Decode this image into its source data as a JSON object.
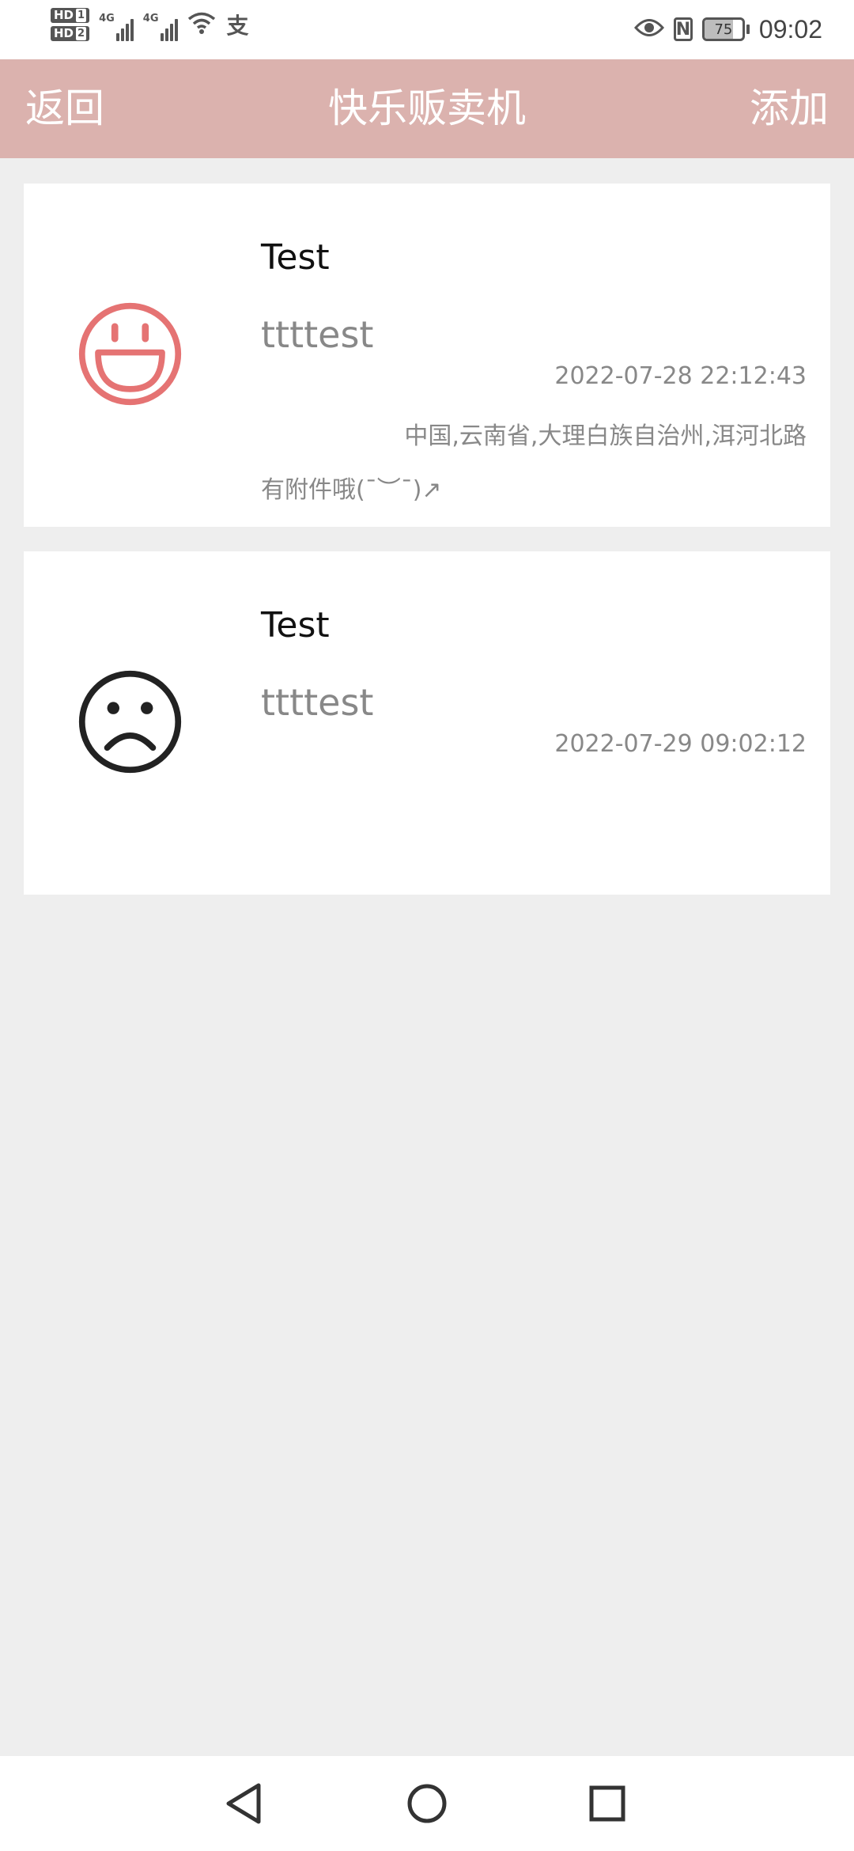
{
  "status_bar": {
    "sim1_label": "HD",
    "sim1_num": "1",
    "sim2_label": "HD",
    "sim2_num": "2",
    "network1": "4G",
    "network2": "4G",
    "alipay_glyph": "支",
    "battery_level": "75",
    "time": "09:02",
    "icons": [
      "wifi-icon",
      "alipay-icon",
      "eye-icon",
      "nfc-icon",
      "battery-icon"
    ]
  },
  "header": {
    "back_label": "返回",
    "title": "快乐贩卖机",
    "add_label": "添加",
    "background_color": "#dbb2ae"
  },
  "entries": [
    {
      "mood": "happy",
      "mood_icon": "happy-face-icon",
      "icon_color": "#e57373",
      "title": "Test",
      "content": "ttttest",
      "time": "2022-07-28 22:12:43",
      "location": "中国,云南省,大理白族自治州,洱河北路",
      "attachment": "有附件哦(ˉ︶ˉ)↗"
    },
    {
      "mood": "sad",
      "mood_icon": "sad-face-icon",
      "icon_color": "#222222",
      "title": "Test",
      "content": "ttttest",
      "time": "2022-07-29 09:02:12",
      "location": "",
      "attachment": ""
    }
  ],
  "nav_bar": {
    "buttons": [
      "back-triangle-icon",
      "home-circle-icon",
      "recents-square-icon"
    ]
  }
}
